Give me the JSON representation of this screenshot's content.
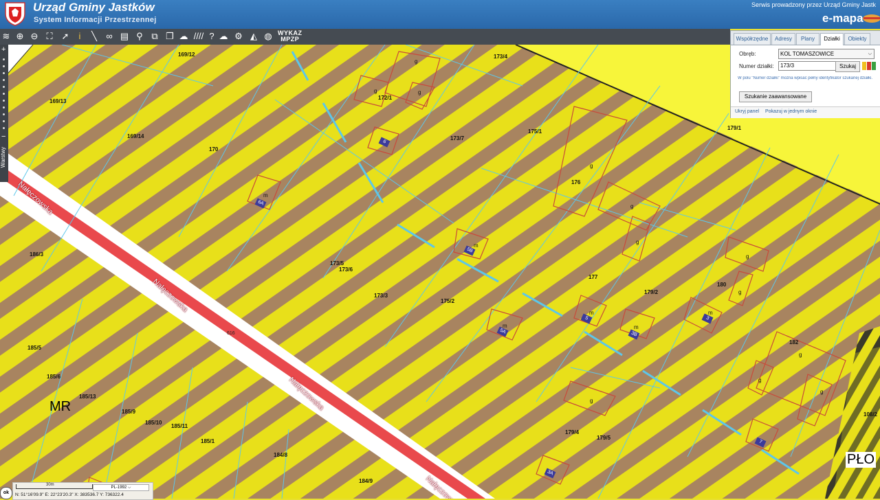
{
  "header": {
    "office_name": "Urząd Gminy Jastków",
    "system_name": "System Informacji Przestrzennej",
    "served_by": "Serwis prowadzony przez Urząd Gminy Jastk",
    "brand": "e-mapa"
  },
  "toolbar": {
    "icons": [
      "layers-icon",
      "zoom-in-icon",
      "zoom-out-icon",
      "zoom-extent-icon",
      "pointer-icon",
      "info-icon",
      "measure-icon",
      "link-icon",
      "print-icon",
      "pin-icon",
      "select-icon",
      "bubble-icon",
      "hatch-icon",
      "help-icon",
      "cloud-icon",
      "settings-icon",
      "warning-icon",
      "marker-icon"
    ],
    "wykaz_label_1": "WYKAZ",
    "wykaz_label_2": "MPZP"
  },
  "side_panel": {
    "tabs": [
      {
        "label": "Współrzędne",
        "active": false
      },
      {
        "label": "Adresy",
        "active": false
      },
      {
        "label": "Plany",
        "active": false
      },
      {
        "label": "Działki",
        "active": true
      },
      {
        "label": "Obiekty",
        "active": false
      }
    ],
    "obreb_label": "Obręb:",
    "obreb_value": "KOL TOMASZOWICE",
    "numer_label": "Numer działki:",
    "numer_value": "173/3",
    "search_button": "Szukaj",
    "hint": "W polu \"Numer działki\" można wpisać pełny identyfikator szukanej działki.",
    "advanced_button": "Szukanie zaawansowane",
    "hide_link": "Ukryj panel",
    "single_window_link": "Pokazuj w jednym oknie"
  },
  "left_bar": {
    "layers_tab": "Warstwy"
  },
  "map": {
    "zones": [
      "MR",
      "PŁO"
    ],
    "street_name": "Nałęczowska",
    "road_number": "616",
    "parcels": [
      "169/12",
      "173/4",
      "169/13",
      "172/1",
      "169/14",
      "170",
      "173/7",
      "175/1",
      "179/1",
      "176",
      "186/3",
      "173/5",
      "173/6",
      "173/3",
      "175/2",
      "177",
      "179/2",
      "180",
      "185/5",
      "185/6",
      "185/13",
      "185/9",
      "185/10",
      "185/11",
      "185/1",
      "184/8",
      "184/9",
      "182",
      "179/4",
      "179/5",
      "108/2"
    ],
    "buildings": [
      "6",
      "6A",
      "5B",
      "5A",
      "5",
      "3B",
      "3",
      "7",
      "3A"
    ],
    "land_use_symbols": [
      "g",
      "m"
    ]
  },
  "status": {
    "scale_label": "30m",
    "crs": "PL-1992",
    "coords": "N: 51°16'09.9\"  E: 22°23'20.3\"  X: 383536.7  Y: 736322.4",
    "ok": "ok"
  },
  "colors": {
    "header": "#2f73b7",
    "toolbar": "#454b52",
    "stripe_yellow": "#e8e01a",
    "stripe_brown": "#a88460",
    "road_red": "#e9494c",
    "boundary_red": "#c84a3a",
    "utility_cyan": "#5cc7ea"
  }
}
